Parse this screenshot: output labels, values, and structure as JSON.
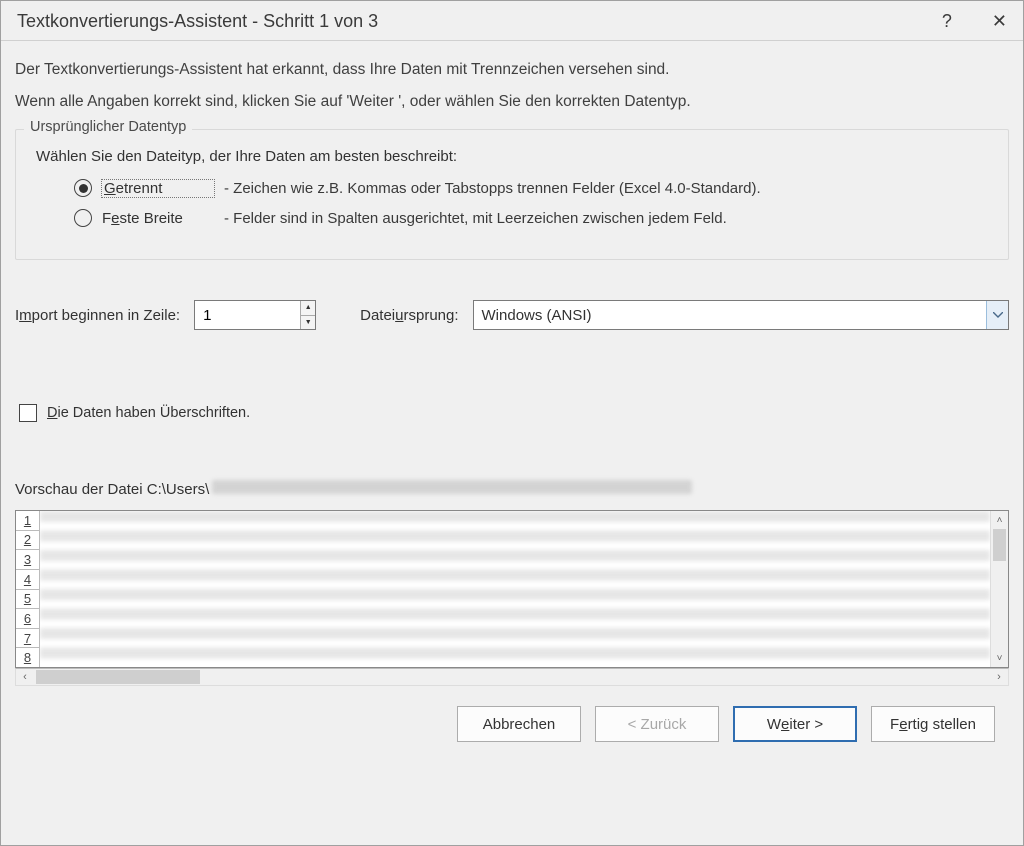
{
  "title": "Textkonvertierungs-Assistent - Schritt 1 von 3",
  "intro": {
    "line1": "Der Textkonvertierungs-Assistent hat erkannt, dass Ihre Daten mit Trennzeichen versehen sind.",
    "line2": "Wenn alle Angaben korrekt sind, klicken Sie auf 'Weiter ', oder wählen Sie den korrekten Datentyp."
  },
  "group_original": {
    "legend": "Ursprünglicher Datentyp",
    "desc": "Wählen Sie den Dateityp, der Ihre Daten am besten beschreibt:",
    "option_delim": {
      "mnemonic": "G",
      "rest": "etrennt",
      "desc": "- Zeichen wie z.B. Kommas oder Tabstopps trennen Felder (Excel 4.0-Standard)."
    },
    "option_fixed": {
      "pre": "F",
      "mnemonic": "e",
      "rest": "ste Breite",
      "desc": "- Felder sind in Spalten ausgerichtet, mit Leerzeichen zwischen jedem Feld."
    }
  },
  "start_row": {
    "pre": "I",
    "mnemonic": "m",
    "rest": "port beginnen in Zeile:",
    "value": "1"
  },
  "origin": {
    "pre": "Datei",
    "mnemonic": "u",
    "rest": "rsprung:",
    "value": "Windows (ANSI)"
  },
  "headers_checkbox": {
    "mnemonic": "D",
    "rest": "ie Daten haben Überschriften."
  },
  "preview": {
    "label_prefix": "Vorschau der Datei C:\\Users\\",
    "rows": [
      "1",
      "2",
      "3",
      "4",
      "5",
      "6",
      "7",
      "8"
    ]
  },
  "buttons": {
    "cancel": "Abbrechen",
    "back": "< Zurück",
    "next_pre": "W",
    "next_mnemonic": "e",
    "next_rest": "iter >",
    "finish_pre": "F",
    "finish_mnemonic": "e",
    "finish_rest": "rtig stellen"
  }
}
